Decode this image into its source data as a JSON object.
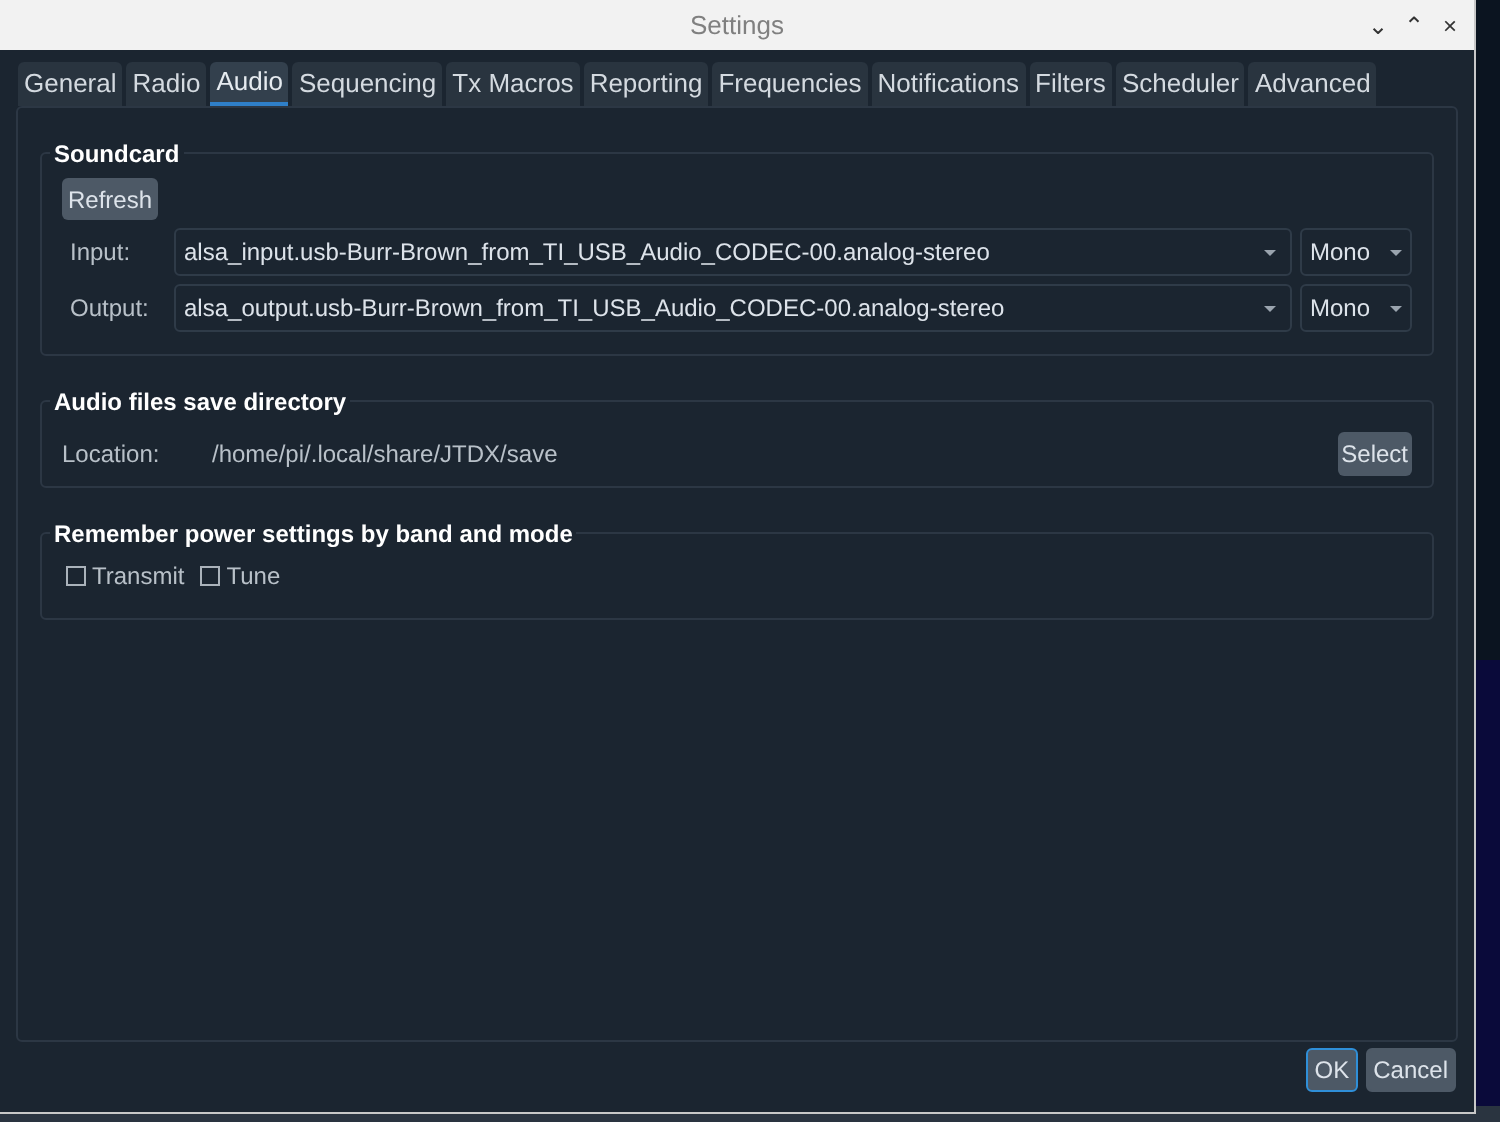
{
  "window": {
    "title": "Settings",
    "controls": [
      "⌄",
      "⌃",
      "×"
    ]
  },
  "tabs": [
    {
      "label": "General",
      "selected": false
    },
    {
      "label": "Radio",
      "selected": false
    },
    {
      "label": "Audio",
      "selected": true
    },
    {
      "label": "Sequencing",
      "selected": false
    },
    {
      "label": "Tx Macros",
      "selected": false
    },
    {
      "label": "Reporting",
      "selected": false
    },
    {
      "label": "Frequencies",
      "selected": false
    },
    {
      "label": "Notifications",
      "selected": false
    },
    {
      "label": "Filters",
      "selected": false
    },
    {
      "label": "Scheduler",
      "selected": false
    },
    {
      "label": "Advanced",
      "selected": false
    }
  ],
  "soundcard": {
    "title": "Soundcard",
    "refresh_button": "Refresh",
    "devices": [
      {
        "label": "Input:",
        "device": "alsa_input.usb-Burr-Brown_from_TI_USB_Audio_CODEC-00.analog-stereo",
        "channel": "Mono"
      },
      {
        "label": "Output:",
        "device": "alsa_output.usb-Burr-Brown_from_TI_USB_Audio_CODEC-00.analog-stereo",
        "channel": "Mono"
      }
    ]
  },
  "save_directory": {
    "title": "Audio files save directory",
    "label": "Location:",
    "path": "/home/pi/.local/share/JTDX/save",
    "select_button": "Select"
  },
  "power_settings": {
    "title": "Remember power settings by band and mode",
    "options": [
      {
        "label": "Transmit",
        "checked": false
      },
      {
        "label": "Tune",
        "checked": false
      }
    ]
  },
  "buttons": [
    {
      "label": "OK",
      "default": true
    },
    {
      "label": "Cancel",
      "default": false
    }
  ]
}
